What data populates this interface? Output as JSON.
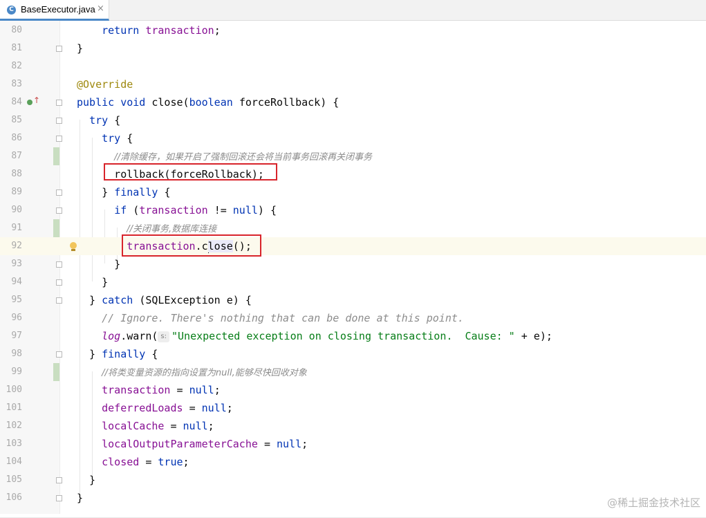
{
  "tab": {
    "icon": "C",
    "title": "BaseExecutor.java",
    "close": "×"
  },
  "lines": [
    {
      "n": "80",
      "tokens": [
        [
          "",
          "    "
        ],
        [
          "kw",
          "return "
        ],
        [
          "fld",
          "transaction"
        ],
        [
          "",
          ";"
        ]
      ]
    },
    {
      "n": "81",
      "tokens": [
        [
          "",
          "}"
        ]
      ]
    },
    {
      "n": "82",
      "tokens": []
    },
    {
      "n": "83",
      "tokens": [
        [
          "ann",
          "@Override"
        ]
      ]
    },
    {
      "n": "84",
      "tokens": [
        [
          "kw",
          "public void "
        ],
        [
          "",
          "close("
        ],
        [
          "kw",
          "boolean "
        ],
        [
          "",
          "forceRollback) {"
        ]
      ]
    },
    {
      "n": "85",
      "tokens": [
        [
          "",
          "  "
        ],
        [
          "kw",
          "try "
        ],
        [
          "",
          "{"
        ]
      ]
    },
    {
      "n": "86",
      "tokens": [
        [
          "",
          "    "
        ],
        [
          "kw",
          "try "
        ],
        [
          "",
          "{"
        ]
      ]
    },
    {
      "n": "87",
      "tokens": [
        [
          "",
          "      "
        ],
        [
          "cmt-cn",
          "//清除缓存，如果开启了强制回滚还会将当前事务回滚再关闭事务"
        ]
      ]
    },
    {
      "n": "88",
      "tokens": [
        [
          "",
          "      rollback(forceRollback);"
        ]
      ]
    },
    {
      "n": "89",
      "tokens": [
        [
          "",
          "    } "
        ],
        [
          "kw",
          "finally "
        ],
        [
          "",
          "{"
        ]
      ]
    },
    {
      "n": "90",
      "tokens": [
        [
          "",
          "      "
        ],
        [
          "kw",
          "if "
        ],
        [
          "",
          "("
        ],
        [
          "fld",
          "transaction "
        ],
        [
          "",
          "!= "
        ],
        [
          "kw",
          "null"
        ],
        [
          "",
          ") {"
        ]
      ]
    },
    {
      "n": "91",
      "tokens": [
        [
          "",
          "        "
        ],
        [
          "cmt-cn",
          "//关闭事务,数据库连接"
        ]
      ]
    },
    {
      "n": "92",
      "tokens": [
        [
          "",
          "        "
        ],
        [
          "fld",
          "transaction"
        ],
        [
          "",
          ".c"
        ],
        [
          "caret",
          ""
        ],
        [
          "hl",
          "lose"
        ],
        [
          "",
          "();"
        ]
      ]
    },
    {
      "n": "93",
      "tokens": [
        [
          "",
          "      }"
        ]
      ]
    },
    {
      "n": "94",
      "tokens": [
        [
          "",
          "    }"
        ]
      ]
    },
    {
      "n": "95",
      "tokens": [
        [
          "",
          "  } "
        ],
        [
          "kw",
          "catch "
        ],
        [
          "",
          "(SQLException e) {"
        ]
      ]
    },
    {
      "n": "96",
      "tokens": [
        [
          "",
          "    "
        ],
        [
          "cmt",
          "// Ignore. There's nothing that can be done at this point."
        ]
      ]
    },
    {
      "n": "97",
      "tokens": [
        [
          "",
          "    "
        ],
        [
          "fld-i",
          "log"
        ],
        [
          "",
          ".warn("
        ],
        [
          "hint",
          "s:"
        ],
        [
          "str",
          "\"Unexpected exception on closing transaction.  Cause: \" "
        ],
        [
          "",
          "+ e);"
        ]
      ]
    },
    {
      "n": "98",
      "tokens": [
        [
          "",
          "  } "
        ],
        [
          "kw",
          "finally "
        ],
        [
          "",
          "{"
        ]
      ]
    },
    {
      "n": "99",
      "tokens": [
        [
          "",
          "    "
        ],
        [
          "cmt-cn",
          "//将类变量资源的指向设置为null,能够尽快回收对象"
        ]
      ]
    },
    {
      "n": "100",
      "tokens": [
        [
          "",
          "    "
        ],
        [
          "fld",
          "transaction "
        ],
        [
          "",
          "= "
        ],
        [
          "kw",
          "null"
        ],
        [
          "",
          ";"
        ]
      ]
    },
    {
      "n": "101",
      "tokens": [
        [
          "",
          "    "
        ],
        [
          "fld",
          "deferredLoads "
        ],
        [
          "",
          "= "
        ],
        [
          "kw",
          "null"
        ],
        [
          "",
          ";"
        ]
      ]
    },
    {
      "n": "102",
      "tokens": [
        [
          "",
          "    "
        ],
        [
          "fld",
          "localCache "
        ],
        [
          "",
          "= "
        ],
        [
          "kw",
          "null"
        ],
        [
          "",
          ";"
        ]
      ]
    },
    {
      "n": "103",
      "tokens": [
        [
          "",
          "    "
        ],
        [
          "fld",
          "localOutputParameterCache "
        ],
        [
          "",
          "= "
        ],
        [
          "kw",
          "null"
        ],
        [
          "",
          ";"
        ]
      ]
    },
    {
      "n": "104",
      "tokens": [
        [
          "",
          "    "
        ],
        [
          "fld",
          "closed "
        ],
        [
          "",
          "= "
        ],
        [
          "kw",
          "true"
        ],
        [
          "",
          ";"
        ]
      ]
    },
    {
      "n": "105",
      "tokens": [
        [
          "",
          "  }"
        ]
      ]
    },
    {
      "n": "106",
      "tokens": [
        [
          "",
          "}"
        ]
      ]
    }
  ],
  "watermark": "@稀土掘金技术社区"
}
